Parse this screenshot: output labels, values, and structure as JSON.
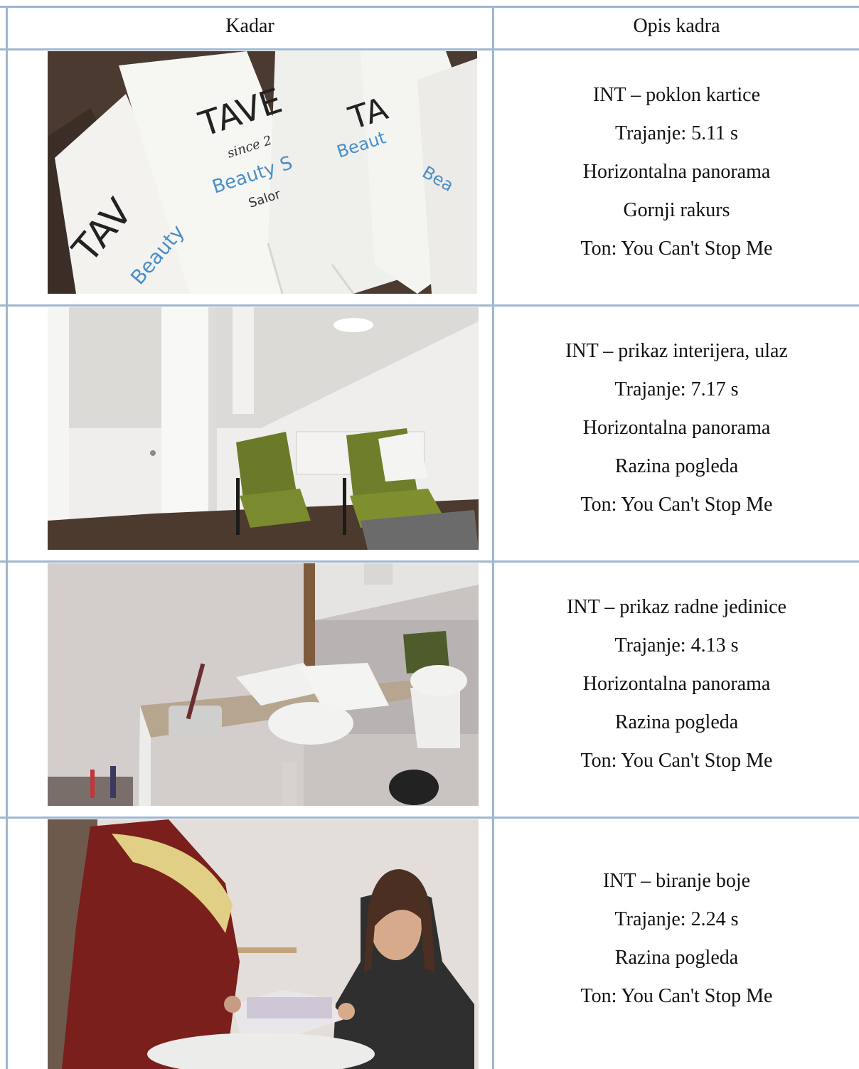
{
  "header": {
    "col1": "Kadar",
    "col2": "Opis kadra"
  },
  "rows": [
    {
      "image_subject": "gift-cards",
      "card_text": {
        "brand": "TAVE",
        "since": "since 2",
        "line1": "Beauty S",
        "line2": "Salor"
      },
      "lines": [
        "INT – poklon kartice",
        "Trajanje: 5.11 s",
        "Horizontalna panorama",
        "Gornji rakurs",
        "Ton: You Can't Stop Me"
      ]
    },
    {
      "image_subject": "interior-entrance",
      "lines": [
        "INT – prikaz interijera, ulaz",
        "Trajanje: 7.17 s",
        "Horizontalna panorama",
        "Razina pogleda",
        "Ton: You Can't Stop Me"
      ]
    },
    {
      "image_subject": "work-station",
      "lines": [
        "INT – prikaz radne jedinice",
        "Trajanje: 4.13 s",
        "Horizontalna panorama",
        "Razina pogleda",
        "Ton: You Can't Stop Me"
      ]
    },
    {
      "image_subject": "choosing-color",
      "lines": [
        "INT – biranje boje",
        "Trajanje: 2.24 s",
        "Razina pogleda",
        "Ton: You Can't Stop Me"
      ]
    }
  ],
  "colors": {
    "border": "#9fb7cf",
    "text": "#111111"
  }
}
